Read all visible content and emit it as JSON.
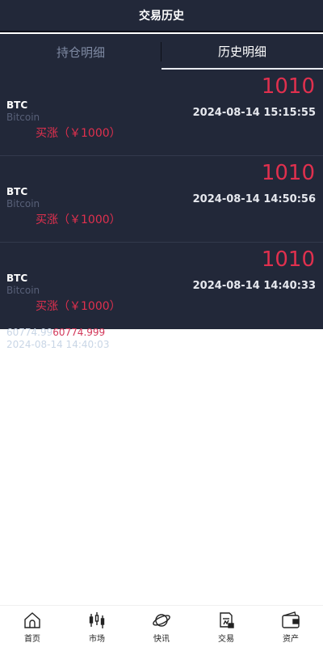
{
  "header": {
    "title": "交易历史"
  },
  "tabs": [
    {
      "label": "持仓明细",
      "active": false
    },
    {
      "label": "历史明细",
      "active": true
    }
  ],
  "records": [
    {
      "symbol": "BTC",
      "name": "Bitcoin",
      "side": "买涨（￥1000）",
      "amount": "1010",
      "time": "2024-08-14 15:15:55"
    },
    {
      "symbol": "BTC",
      "name": "Bitcoin",
      "side": "买涨（￥1000）",
      "amount": "1010",
      "time": "2024-08-14 14:50:56"
    },
    {
      "symbol": "BTC",
      "name": "Bitcoin",
      "side": "买涨（￥1000）",
      "amount": "1010",
      "time": "2024-08-14 14:40:33"
    }
  ],
  "overflow": {
    "price_a": "60774.99",
    "price_b": "60774.999",
    "time": "2024-08-14 14:40:03"
  },
  "colors": {
    "up": "#e0304e",
    "panel": "#222839"
  },
  "nav": [
    {
      "label": "首页",
      "icon": "home-icon"
    },
    {
      "label": "市场",
      "icon": "candlestick-icon"
    },
    {
      "label": "快讯",
      "icon": "planet-icon"
    },
    {
      "label": "交易",
      "icon": "trade-doc-icon"
    },
    {
      "label": "资产",
      "icon": "wallet-icon"
    }
  ]
}
